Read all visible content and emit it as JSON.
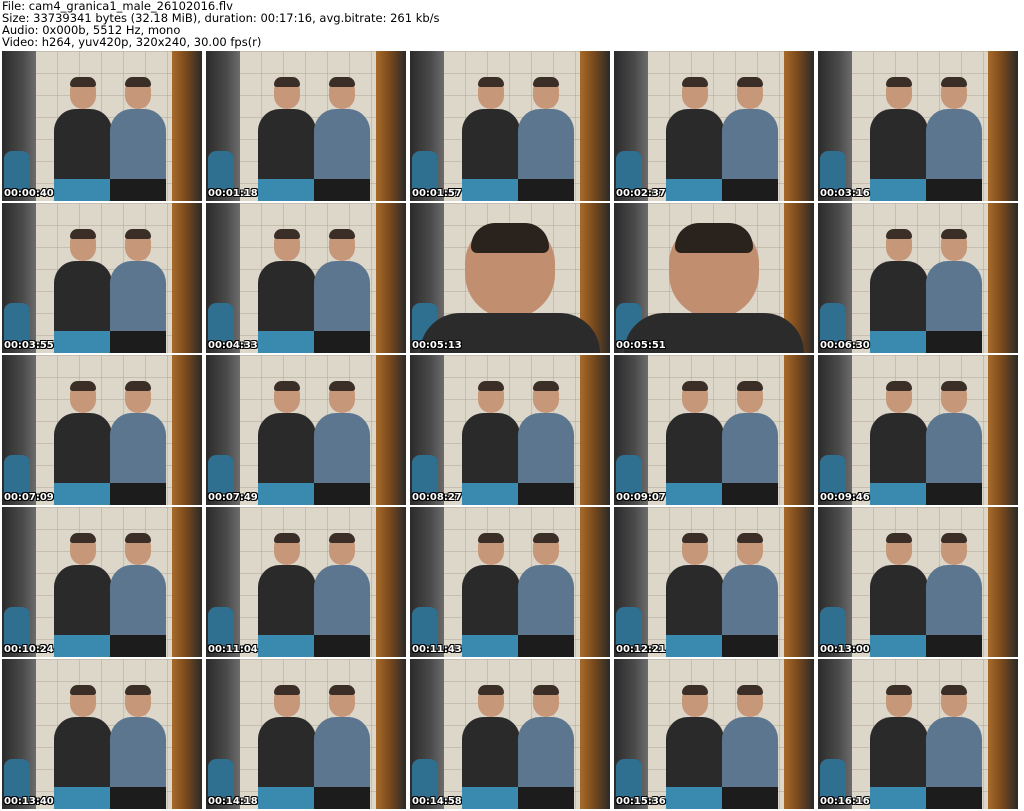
{
  "header": {
    "file": "File: cam4_granica1_male_26102016.flv",
    "size": "Size: 33739341 bytes (32.18 MiB), duration: 00:17:16, avg.bitrate: 261 kb/s",
    "audio": "Audio: 0x000b, 5512 Hz, mono",
    "video": "Video: h264, yuv420p, 320x240, 30.00 fps(r)"
  },
  "thumbnails": [
    {
      "time": "00:00:40",
      "variant": "v-selfie"
    },
    {
      "time": "00:01:18",
      "variant": "v-duo"
    },
    {
      "time": "00:01:57",
      "variant": "v-duo"
    },
    {
      "time": "00:02:37",
      "variant": "v-duo"
    },
    {
      "time": "00:03:16",
      "variant": "v-duo"
    },
    {
      "time": "00:03:55",
      "variant": "v-duo"
    },
    {
      "time": "00:04:33",
      "variant": "v-duo"
    },
    {
      "time": "00:05:13",
      "variant": "v-big"
    },
    {
      "time": "00:05:51",
      "variant": "v-big"
    },
    {
      "time": "00:06:30",
      "variant": "v-duo"
    },
    {
      "time": "00:07:09",
      "variant": "v-duo"
    },
    {
      "time": "00:07:49",
      "variant": "v-duo"
    },
    {
      "time": "00:08:27",
      "variant": "v-duo"
    },
    {
      "time": "00:09:07",
      "variant": "v-duo"
    },
    {
      "time": "00:09:46",
      "variant": "v-duo"
    },
    {
      "time": "00:10:24",
      "variant": "v-duo"
    },
    {
      "time": "00:11:04",
      "variant": "v-selfie"
    },
    {
      "time": "00:11:43",
      "variant": "v-duo"
    },
    {
      "time": "00:12:21",
      "variant": "v-duo"
    },
    {
      "time": "00:13:00",
      "variant": "v-selfie"
    },
    {
      "time": "00:13:40",
      "variant": "v-duo"
    },
    {
      "time": "00:14:18",
      "variant": "v-selfie"
    },
    {
      "time": "00:14:58",
      "variant": "v-duo"
    },
    {
      "time": "00:15:36",
      "variant": "v-duo"
    },
    {
      "time": "00:16:16",
      "variant": "v-duo"
    }
  ]
}
